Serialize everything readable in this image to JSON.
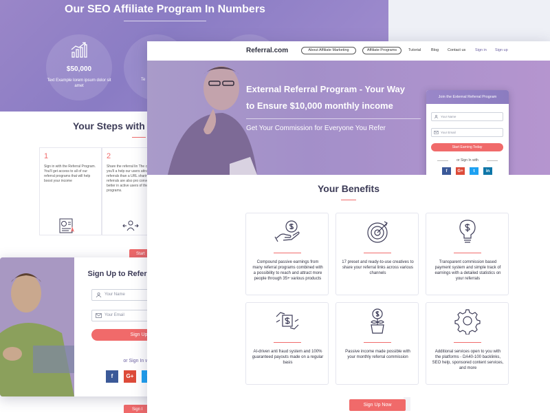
{
  "numbers": {
    "title": "Our SEO Affiliate Program In Numbers",
    "stat_value": "$50,000",
    "stat_caption": "Text Example lorem ipsum dolor sit amet",
    "stat_caption_partial": "Te"
  },
  "steps": {
    "title": "Your Steps with B",
    "items": [
      {
        "num": "1",
        "text": "Sign in with the Referral Program. You'll get access to all of our referral programs that will help boost your income"
      },
      {
        "num": "2",
        "text": "Share the referral lin The creatives you'll a help our users attract more referrals than a URL sharing. These referrals are also pro convert 16% better in active users of the re programs."
      }
    ],
    "btn_partial_1": "Start",
    "btn_partial_2": "Sign I"
  },
  "signup": {
    "title": "Sign Up to Referral Program",
    "name_placeholder": "Your Name",
    "email_placeholder": "Your Email",
    "button": "Sign Up",
    "or_text": "or Sign In with"
  },
  "site": {
    "logo": "Referral.com",
    "nav": {
      "about": "About Affiliate Marketing",
      "programs": "Affiliate Programs",
      "tutorial": "Tutorial",
      "blog": "Blog",
      "contact": "Contact us",
      "signin": "Sign in",
      "signup": "Sign up"
    },
    "hero": {
      "title_line1": "External Referral Program - Your Way",
      "title_line2": "to Ensure $10,000 monthly income",
      "subtitle": "Get Your Commission for Everyone You Refer"
    },
    "join": {
      "header": "Join the External Referral Program",
      "name_placeholder": "Your Name",
      "email_placeholder": "Your Email",
      "button": "Start Earning Today",
      "or_text": "or Sign In with"
    },
    "benefits": {
      "title": "Your Benefits",
      "items": [
        {
          "icon": "hand-dollar-icon",
          "text": "Compound passive earnings from many referral programs combined with a possibility to reach and attract more people through 35+ various products"
        },
        {
          "icon": "target-icon",
          "text": "17 preset and ready-to-use creatives to share your referral links across various channels"
        },
        {
          "icon": "lightbulb-dollar-icon",
          "text": "Transparent commission based payment system and simple track of earnings with a detailed statistics on your referrals"
        },
        {
          "icon": "secure-payout-icon",
          "text": "AI-driven anti fraud system and 100% guaranteed payouts made on a regular basis"
        },
        {
          "icon": "money-plant-icon",
          "text": "Passive income made possible with your monthly referral commission"
        },
        {
          "icon": "gear-icon",
          "text": "Additional services open to you with the platforms - DA40-100 backlinks, SEO help, sponsored content services, and more"
        }
      ]
    },
    "cta": "Sign Up Now"
  },
  "social": {
    "facebook": "f",
    "google": "G+",
    "twitter": "t",
    "linkedin": "in"
  },
  "colors": {
    "accent": "#f06a6a",
    "brand_purple": "#8b7cc0",
    "heading": "#3b3a56"
  }
}
